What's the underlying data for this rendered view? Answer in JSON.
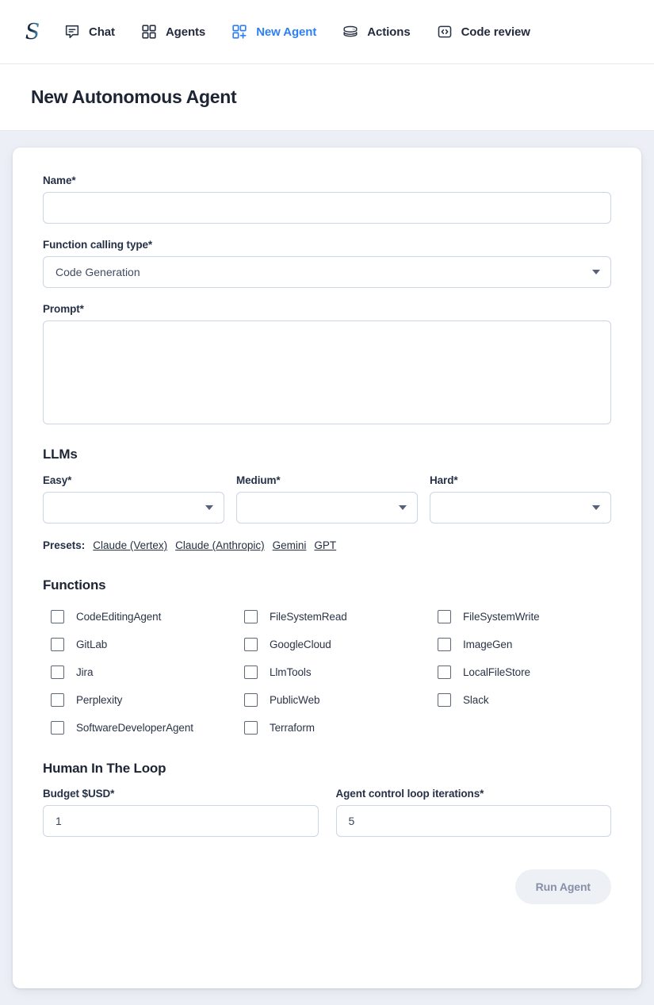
{
  "nav": {
    "logo_alt": "sophia-logo",
    "items": [
      {
        "label": "Chat",
        "icon": "chat-bubble-icon",
        "active": false
      },
      {
        "label": "Agents",
        "icon": "grid-icon",
        "active": false
      },
      {
        "label": "New Agent",
        "icon": "grid-plus-icon",
        "active": true
      },
      {
        "label": "Actions",
        "icon": "server-stack-icon",
        "active": false
      },
      {
        "label": "Code review",
        "icon": "code-brackets-icon",
        "active": false
      }
    ],
    "active_color": "#2d7ff9"
  },
  "header": {
    "title": "New Autonomous Agent"
  },
  "form": {
    "name": {
      "label": "Name*",
      "value": "",
      "placeholder": ""
    },
    "function_calling_type": {
      "label": "Function calling type*",
      "value": "Code Generation",
      "options": [
        "Code Generation"
      ]
    },
    "prompt": {
      "label": "Prompt*",
      "value": "",
      "placeholder": ""
    },
    "llms": {
      "heading": "LLMs",
      "fields": [
        {
          "label": "Easy*",
          "value": ""
        },
        {
          "label": "Medium*",
          "value": ""
        },
        {
          "label": "Hard*",
          "value": ""
        }
      ],
      "presets_label": "Presets:",
      "presets": [
        "Claude (Vertex)",
        "Claude (Anthropic)",
        "Gemini",
        "GPT"
      ]
    },
    "functions": {
      "heading": "Functions",
      "items": [
        {
          "label": "CodeEditingAgent",
          "checked": false
        },
        {
          "label": "FileSystemRead",
          "checked": false
        },
        {
          "label": "FileSystemWrite",
          "checked": false
        },
        {
          "label": "GitLab",
          "checked": false
        },
        {
          "label": "GoogleCloud",
          "checked": false
        },
        {
          "label": "ImageGen",
          "checked": false
        },
        {
          "label": "Jira",
          "checked": false
        },
        {
          "label": "LlmTools",
          "checked": false
        },
        {
          "label": "LocalFileStore",
          "checked": false
        },
        {
          "label": "Perplexity",
          "checked": false
        },
        {
          "label": "PublicWeb",
          "checked": false
        },
        {
          "label": "Slack",
          "checked": false
        },
        {
          "label": "SoftwareDeveloperAgent",
          "checked": false
        },
        {
          "label": "Terraform",
          "checked": false
        }
      ]
    },
    "human_in_the_loop": {
      "heading": "Human In The Loop",
      "budget": {
        "label": "Budget $USD*",
        "value": "1"
      },
      "iterations": {
        "label": "Agent control loop iterations*",
        "value": "5"
      }
    },
    "submit": {
      "label": "Run Agent",
      "disabled": true
    }
  }
}
